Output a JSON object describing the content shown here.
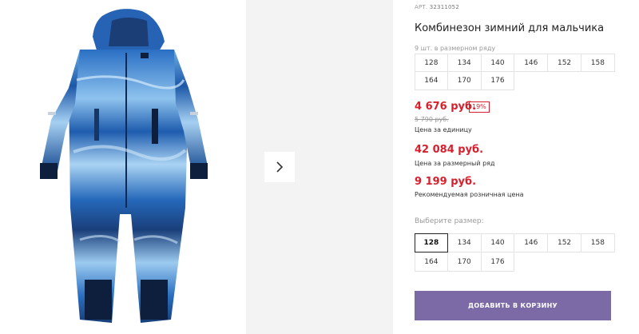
{
  "product": {
    "article_prefix": "АРТ.",
    "article_number": "32311052",
    "title": "Комбинезон зимний для мальчика",
    "pack_note": "9 шт. в размерном ряду"
  },
  "pack_sizes": [
    "128",
    "134",
    "140",
    "146",
    "152",
    "158",
    "164",
    "170",
    "176"
  ],
  "pricing": {
    "unit_price": "4 676 руб.",
    "discount": "19%",
    "old_price": "5 790 руб.",
    "unit_label": "Цена за единицу",
    "pack_price": "42 084 руб.",
    "pack_label": "Цена за размерный ряд",
    "rrp_price": "9 199 руб.",
    "rrp_label": "Рекомендуемая розничная цена"
  },
  "size_selector": {
    "label": "Выберите размер:",
    "sizes": [
      "128",
      "134",
      "140",
      "146",
      "152",
      "158",
      "164",
      "170",
      "176"
    ],
    "selected": "128"
  },
  "cart_button": "ДОБАВИТЬ В КОРЗИНУ",
  "colors": {
    "price_red": "#d6202e",
    "button_purple": "#7b6aa6",
    "suit_blue": "#1f63b8",
    "suit_dark": "#0d1f3c"
  },
  "icons": {
    "next": "chevron-right-icon"
  }
}
